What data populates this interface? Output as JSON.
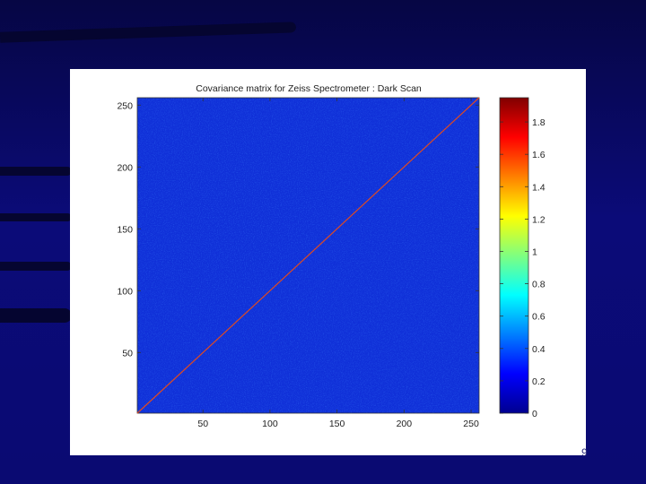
{
  "slide": {
    "page_number": "9",
    "background_color": "#0a0a6e"
  },
  "chart_data": {
    "type": "heatmap",
    "title": "Covariance matrix for Zeiss Spectrometer : Dark Scan",
    "xlabel": "",
    "ylabel": "",
    "matrix_size": 256,
    "xlim": [
      1,
      256
    ],
    "ylim": [
      1,
      256
    ],
    "x_ticks": [
      50,
      100,
      150,
      200,
      250
    ],
    "y_ticks": [
      50,
      100,
      150,
      200,
      250
    ],
    "off_diagonal_typical": 0.15,
    "diagonal_value": 1.0,
    "colorbar": {
      "range": [
        0,
        1.95
      ],
      "ticks": [
        0,
        0.2,
        0.4,
        0.6,
        0.8,
        1,
        1.2,
        1.4,
        1.6,
        1.8
      ],
      "colormap": "jet"
    },
    "grid": false
  }
}
